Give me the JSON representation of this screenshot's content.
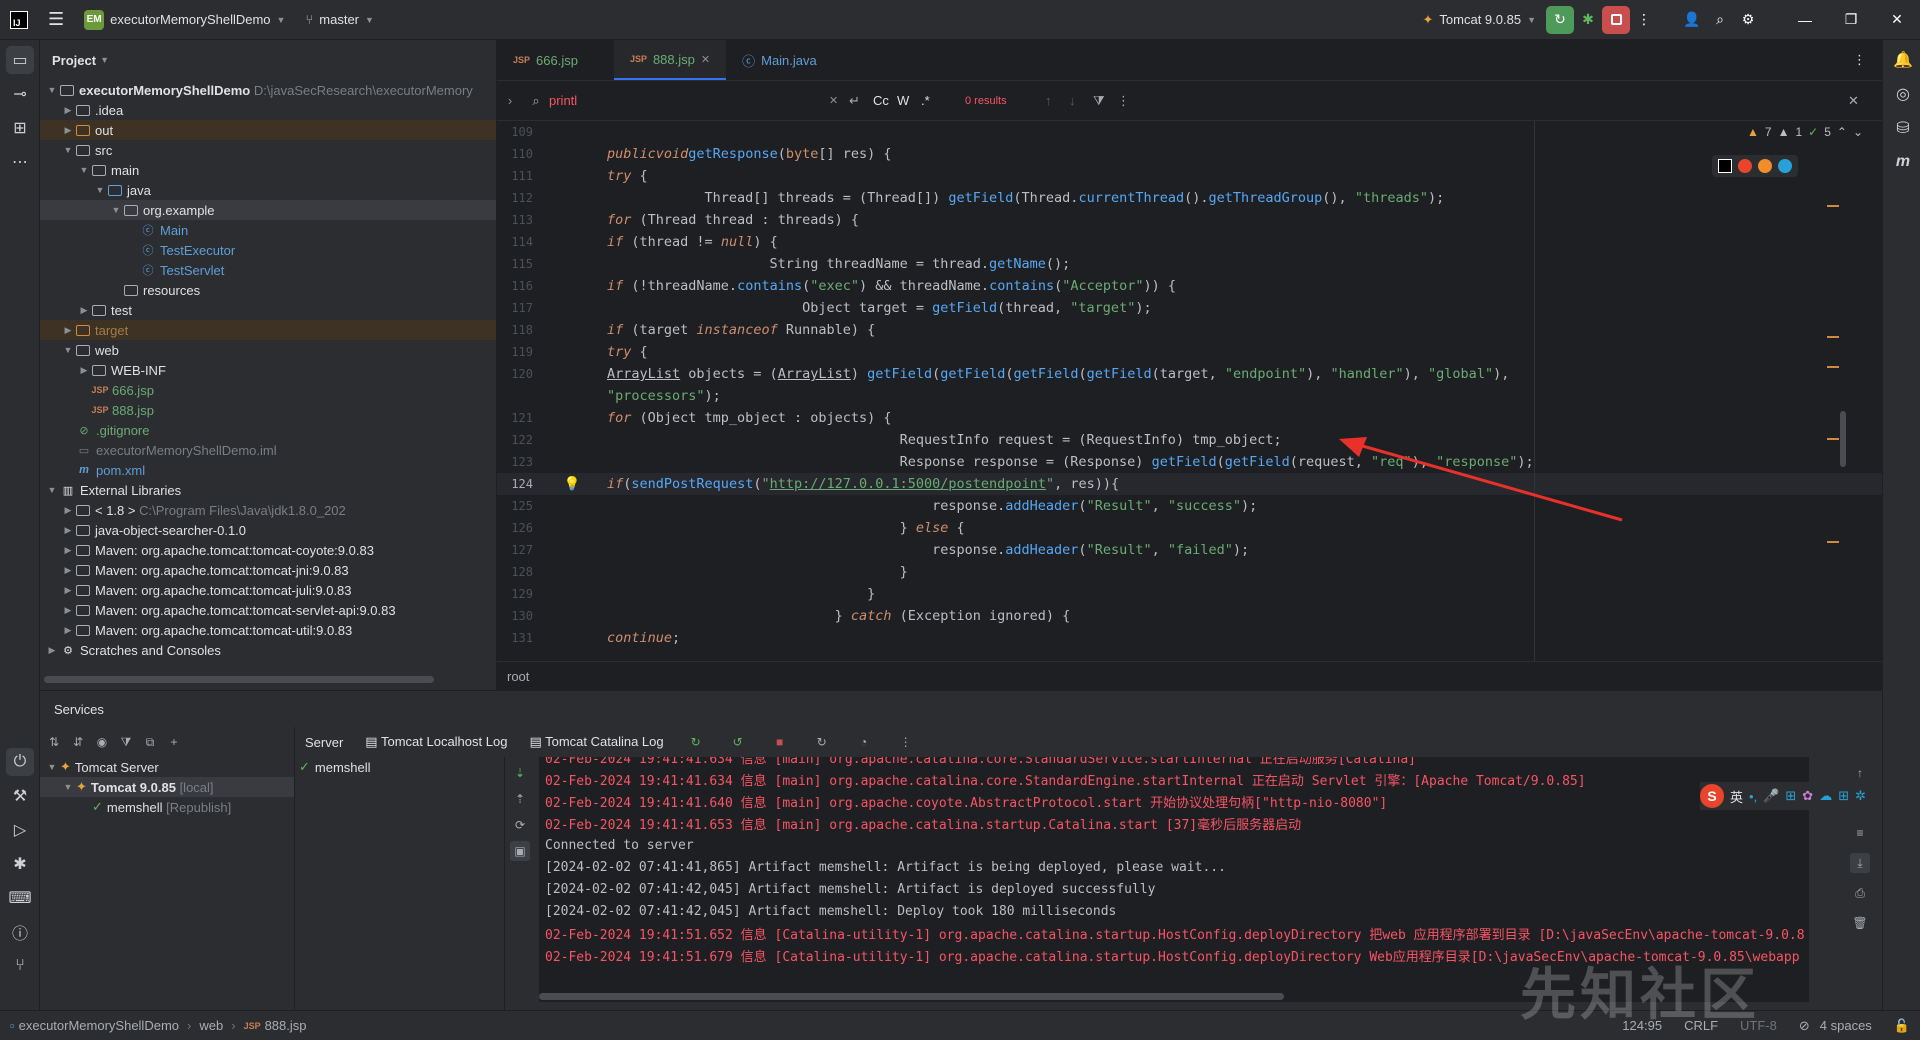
{
  "topbar": {
    "project_badge": "EM",
    "project_name": "executorMemoryShellDemo",
    "branch": "master",
    "run_config": "Tomcat 9.0.85"
  },
  "project_panel": {
    "title": "Project",
    "rows": [
      {
        "label": "executorMemoryShellDemo",
        "extra": "D:\\javaSecResearch\\executorMemory"
      },
      {
        "label": ".idea"
      },
      {
        "label": "out"
      },
      {
        "label": "src"
      },
      {
        "label": "main"
      },
      {
        "label": "java"
      },
      {
        "label": "org.example"
      },
      {
        "label": "Main"
      },
      {
        "label": "TestExecutor"
      },
      {
        "label": "TestServlet"
      },
      {
        "label": "resources"
      },
      {
        "label": "test"
      },
      {
        "label": "target"
      },
      {
        "label": "web"
      },
      {
        "label": "WEB-INF"
      },
      {
        "label": "666.jsp"
      },
      {
        "label": "888.jsp"
      },
      {
        "label": ".gitignore"
      },
      {
        "label": "executorMemoryShellDemo.iml"
      },
      {
        "label": "pom.xml"
      },
      {
        "label": "External Libraries"
      },
      {
        "label": "< 1.8 >",
        "extra": "C:\\Program Files\\Java\\jdk1.8.0_202"
      },
      {
        "label": "java-object-searcher-0.1.0"
      },
      {
        "label": "Maven: org.apache.tomcat:tomcat-coyote:9.0.83"
      },
      {
        "label": "Maven: org.apache.tomcat:tomcat-jni:9.0.83"
      },
      {
        "label": "Maven: org.apache.tomcat:tomcat-juli:9.0.83"
      },
      {
        "label": "Maven: org.apache.tomcat:tomcat-servlet-api:9.0.83"
      },
      {
        "label": "Maven: org.apache.tomcat:tomcat-util:9.0.83"
      },
      {
        "label": "Scratches and Consoles"
      }
    ]
  },
  "editor": {
    "tabs": [
      {
        "label": "666.jsp"
      },
      {
        "label": "888.jsp"
      },
      {
        "label": "Main.java"
      }
    ],
    "find": {
      "query": "printl",
      "results": "0 results"
    },
    "inspections": {
      "warnings": "7",
      "weak": "1",
      "ok": "5"
    },
    "breadcrumb": "root",
    "line_numbers": [
      "109",
      "110",
      "111",
      "112",
      "113",
      "114",
      "115",
      "116",
      "117",
      "118",
      "119",
      "120",
      "",
      "121",
      "122",
      "123",
      "124",
      "125",
      "126",
      "127",
      "128",
      "129",
      "130",
      "131"
    ]
  },
  "services": {
    "title": "Services",
    "tree": [
      {
        "label": "Tomcat Server"
      },
      {
        "label": "Tomcat 9.0.85",
        "extra": "[local]"
      },
      {
        "label": "memshell",
        "extra": "[Republish]"
      }
    ],
    "tabs": [
      {
        "label": "Server"
      },
      {
        "label": "Tomcat Localhost Log"
      },
      {
        "label": "Tomcat Catalina Log"
      }
    ],
    "deployment": "memshell",
    "log": [
      {
        "text": "02-Feb-2024 19:41:41.634 信息 [main] org.apache.catalina.core.StandardService.startInternal 正在启动服务[Catalina]",
        "color": "red"
      },
      {
        "text": "02-Feb-2024 19:41:41.634 信息 [main] org.apache.catalina.core.StandardEngine.startInternal 正在启动 Servlet 引擎：[Apache Tomcat/9.0.85]",
        "color": "red"
      },
      {
        "text": "02-Feb-2024 19:41:41.640 信息 [main] org.apache.coyote.AbstractProtocol.start 开始协议处理句柄[\"http-nio-8080\"]",
        "color": "red"
      },
      {
        "text": "02-Feb-2024 19:41:41.653 信息 [main] org.apache.catalina.startup.Catalina.start [37]毫秒后服务器启动",
        "color": "red"
      },
      {
        "text": "Connected to server",
        "color": "white"
      },
      {
        "text": "[2024-02-02 07:41:41,865] Artifact memshell: Artifact is being deployed, please wait...",
        "color": "white"
      },
      {
        "text": "[2024-02-02 07:41:42,045] Artifact memshell: Artifact is deployed successfully",
        "color": "white"
      },
      {
        "text": "[2024-02-02 07:41:42,045] Artifact memshell: Deploy took 180 milliseconds",
        "color": "white"
      },
      {
        "text": "02-Feb-2024 19:41:51.652 信息 [Catalina-utility-1] org.apache.catalina.startup.HostConfig.deployDirectory 把web 应用程序部署到目录 [D:\\javaSecEnv\\apache-tomcat-9.0.8",
        "color": "red"
      },
      {
        "text": "02-Feb-2024 19:41:51.679 信息 [Catalina-utility-1] org.apache.catalina.startup.HostConfig.deployDirectory Web应用程序目录[D:\\javaSecEnv\\apache-tomcat-9.0.85\\webapp",
        "color": "red"
      }
    ]
  },
  "statusbar": {
    "crumbs": [
      "executorMemoryShellDemo",
      "web",
      "888.jsp"
    ],
    "position": "124:95",
    "line_sep": "CRLF",
    "encoding": "UTF-8",
    "indent": "4 spaces"
  },
  "ime": {
    "lang": "英"
  },
  "watermark": "先知社区"
}
